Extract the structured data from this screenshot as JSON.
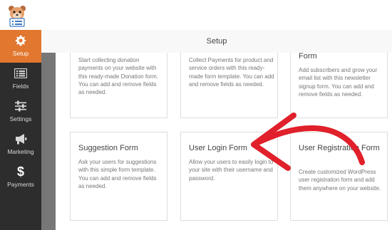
{
  "header": {
    "title": "Setup"
  },
  "sidebar": {
    "items": [
      {
        "label": "Setup",
        "icon": "gear-icon",
        "active": true
      },
      {
        "label": "Fields",
        "icon": "list-icon"
      },
      {
        "label": "Settings",
        "icon": "sliders-icon"
      },
      {
        "label": "Marketing",
        "icon": "megaphone-icon"
      },
      {
        "label": "Payments",
        "icon": "dollar-icon"
      }
    ]
  },
  "templates": [
    {
      "title": "",
      "description": "Start collecting donation payments on your website with this ready-made Donation form. You can add and remove fields as needed."
    },
    {
      "title": "",
      "description": "Collect Payments for product and service orders with this ready-made form template. You can add and remove fields as needed."
    },
    {
      "title": "Form",
      "description": "Add subscribers and grow your email list with this newsletter signup form. You can add and remove fields as needed."
    },
    {
      "title": "Suggestion Form",
      "description": "Ask your users for suggestions with this simple form template. You can add and remove fields as needed."
    },
    {
      "title": "User Login Form",
      "description": "Allow your users to easily login to your site with their username and password."
    },
    {
      "title": "User Registration Form",
      "description": "Create customized WordPress user registration form and add them anywhere on your website."
    }
  ],
  "colors": {
    "accent": "#e27730",
    "annotation_arrow": "#e0202a",
    "sidebar_bg": "#2d2d2d"
  }
}
